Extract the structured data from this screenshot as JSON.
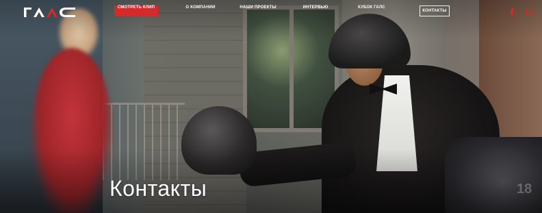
{
  "brand": {
    "logo_icon": "gals-logo"
  },
  "nav": {
    "items": [
      {
        "label": "СМОТРЕТЬ КЛИП",
        "style": "cta",
        "color": "#d42a2a"
      },
      {
        "label": "О КОМПАНИИ"
      },
      {
        "label": "НАШИ ПРОЕКТЫ"
      },
      {
        "label": "ИНТЕРВЬЮ"
      },
      {
        "label": "КУБОК ГАЛС"
      },
      {
        "label": "КОНТАКТЫ",
        "style": "active-outline"
      }
    ]
  },
  "social": [
    {
      "icon": "facebook-icon",
      "color": "#d42a2a"
    },
    {
      "icon": "youtube-icon",
      "color": "#d42a2a"
    }
  ],
  "hero": {
    "title": "Контакты",
    "image": "man-in-tuxedo-with-motorcycle-helmet"
  },
  "colors": {
    "accent": "#d42a2a",
    "text": "#ffffff"
  }
}
